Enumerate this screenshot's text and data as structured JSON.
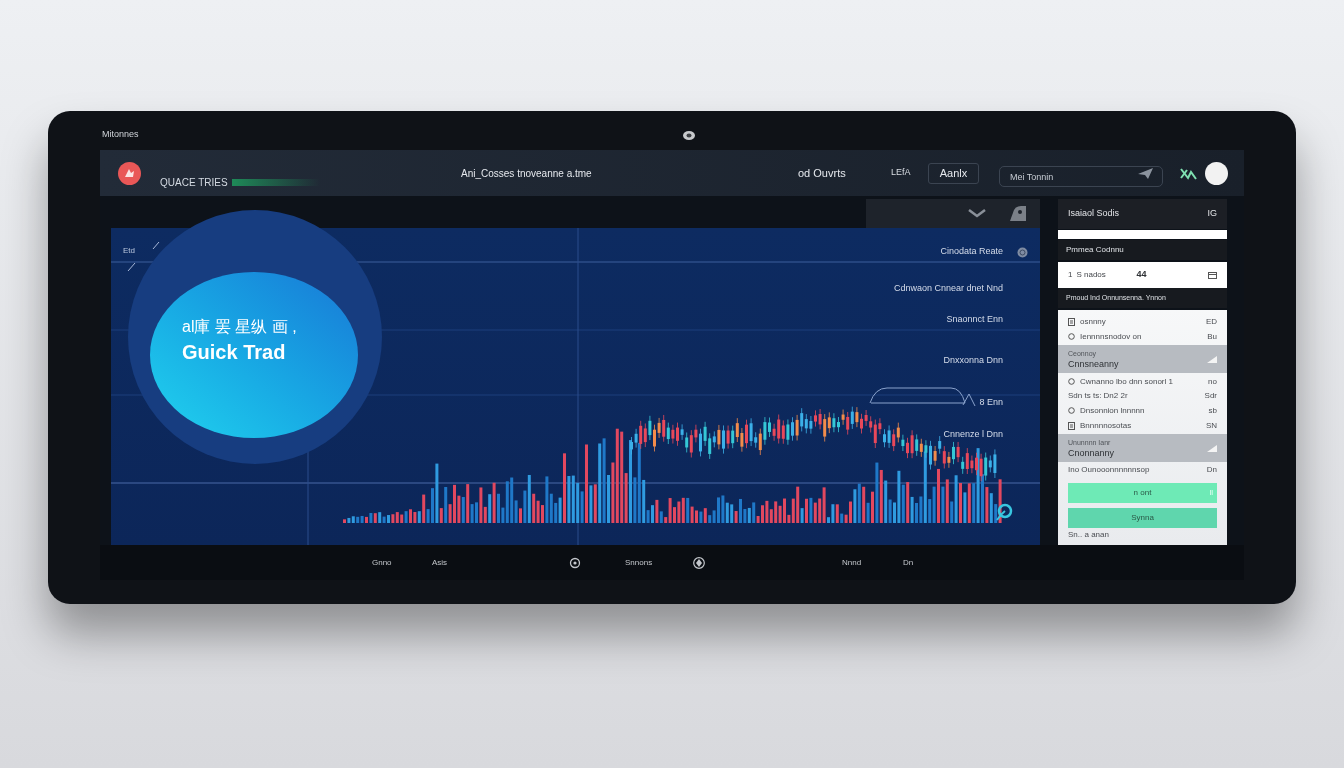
{
  "device": {
    "label": "Mitonnes"
  },
  "header": {
    "app_name": "QUACE TRIES",
    "tagline": "Ani_Cosses tnoveanne a.tme",
    "menu_link": "od Ouvrts",
    "language": "LEfA",
    "button": "Aanlx",
    "search": {
      "placeholder": "Mei Tonnin"
    }
  },
  "chart_panel": {
    "corner_label": "Etd",
    "badge": {
      "line_1": "al庫 罢 星纵 画 ,",
      "line_2": "Guick Trad"
    },
    "price_labels": [
      {
        "kind": "marker",
        "label": "Cinodata Reate"
      },
      {
        "kind": "plain",
        "label": "Cdnwaon Cnnear dnet Nnd"
      },
      {
        "kind": "plain",
        "label": "Snaonnct Enn"
      },
      {
        "kind": "plain",
        "label": "Dnxxonna Dnn"
      },
      {
        "kind": "plain",
        "label": "8 Enn"
      },
      {
        "kind": "plain",
        "label": "Cnnenze l Dnn"
      }
    ]
  },
  "sidebar": {
    "title": "Isaiaol Sodis",
    "title_badge": "IG",
    "section_1": "Pmmea Codnnu",
    "selector": {
      "count": "1",
      "label": "S nados",
      "value": "44"
    },
    "section_2": "Pmoud Ind Onnunsenna. Ynnon",
    "rows": [
      {
        "kind": "icon_item",
        "label": "osnnny",
        "value": "ED"
      },
      {
        "kind": "icon_item",
        "label": "Iennnnsnodov on",
        "value": "Bu"
      },
      {
        "kind": "group",
        "label": "Ceonnoy",
        "sublabel": "Cnnsneanny"
      },
      {
        "kind": "icon_item",
        "label": "Cwnanno lbo dnn sonorl 1",
        "value": "no"
      },
      {
        "kind": "item",
        "label": "Sdn ts ts: Dn2 2r",
        "value": "Sdr"
      },
      {
        "kind": "icon_item",
        "label": "Dnsonnion lnnnnn",
        "value": "sb"
      },
      {
        "kind": "icon_item",
        "label": "Bnnnnnosotas",
        "value": "SN"
      },
      {
        "kind": "group",
        "label": "Ununnnn Ianr",
        "sublabel": "Cnonnanny"
      },
      {
        "kind": "item",
        "label": "Ino Ounooonnnnnnsop",
        "value": "Dn"
      },
      {
        "kind": "button",
        "label": "n ont",
        "value": "ll"
      },
      {
        "kind": "button",
        "label": "Synna"
      },
      {
        "kind": "item",
        "label": "Sn.. a anan"
      }
    ]
  },
  "footer": {
    "left": [
      "Gnno",
      "Asis"
    ],
    "center": "Snnons",
    "right": [
      "Nnnd",
      "Dn"
    ]
  }
}
